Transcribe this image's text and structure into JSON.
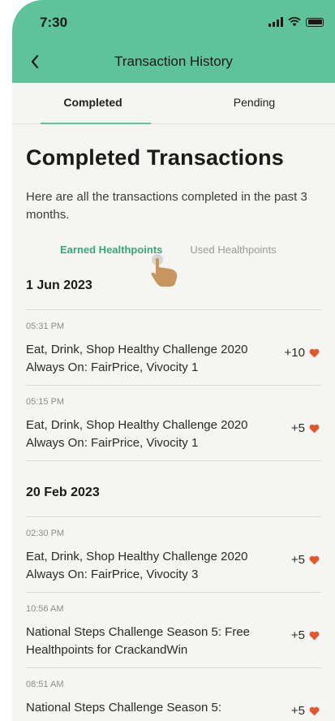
{
  "status_bar": {
    "time": "7:30"
  },
  "header": {
    "title": "Transaction History"
  },
  "tabs": [
    {
      "label": "Completed",
      "active": true
    },
    {
      "label": "Pending",
      "active": false
    }
  ],
  "main": {
    "heading": "Completed Transactions",
    "intro": "Here are all the transactions completed in the past 3 months.",
    "filters": [
      {
        "label": "Earned Healthpoints",
        "active": true
      },
      {
        "label": "Used Healthpoints",
        "active": false
      }
    ],
    "groups": [
      {
        "date": "1 Jun 2023",
        "transactions": [
          {
            "time": "05:31 PM",
            "description": "Eat, Drink, Shop Healthy Challenge 2020 Always On: FairPrice, Vivocity 1",
            "points": "+10"
          },
          {
            "time": "05:15 PM",
            "description": "Eat, Drink, Shop Healthy Challenge 2020 Always On: FairPrice, Vivocity 1",
            "points": "+5"
          }
        ]
      },
      {
        "date": "20 Feb 2023",
        "transactions": [
          {
            "time": "02:30 PM",
            "description": "Eat, Drink, Shop Healthy Challenge 2020 Always On: FairPrice, Vivocity 3",
            "points": "+5"
          },
          {
            "time": "10:56 AM",
            "description": "National Steps Challenge Season 5: Free Healthpoints for CrackandWin",
            "points": "+5"
          },
          {
            "time": "08:51 AM",
            "description": "National Steps Challenge Season 5:",
            "points": "+5"
          }
        ]
      }
    ]
  },
  "colors": {
    "accent": "#5fc39a",
    "filter_active": "#3aa57b",
    "heart": "#e4572e"
  },
  "icons": {
    "back": "chevron-left-icon",
    "points": "heart-icon",
    "pointer": "hand-pointer-icon"
  }
}
